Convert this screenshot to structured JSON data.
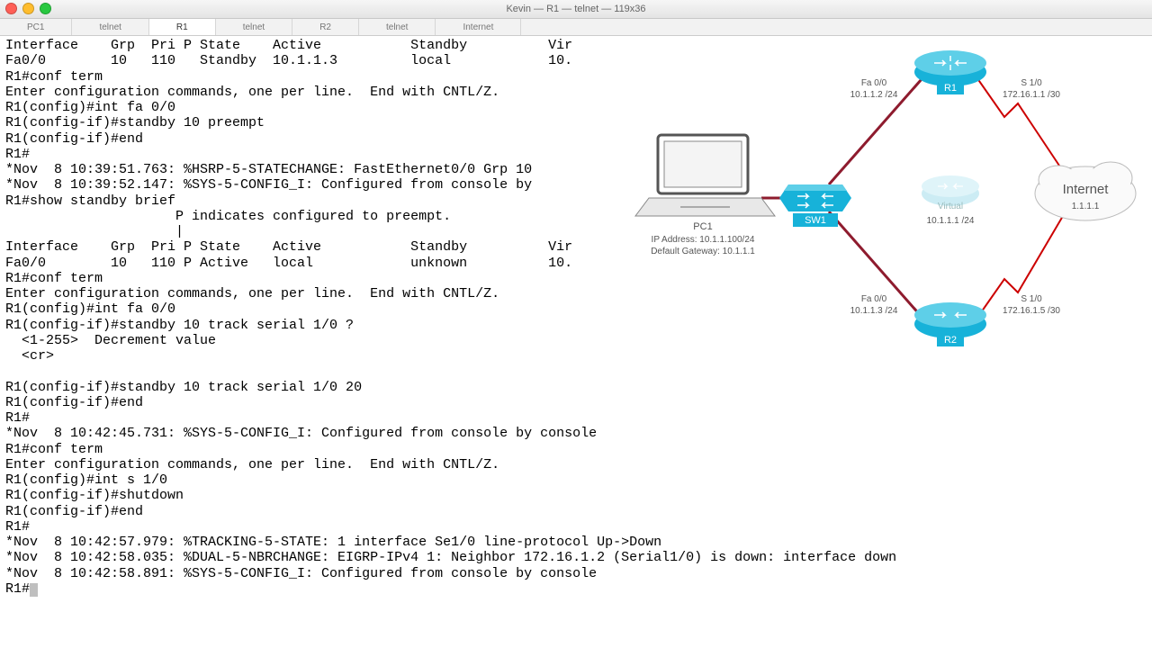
{
  "window": {
    "title": "Kevin — R1 — telnet — 119x36"
  },
  "tabs": {
    "items": [
      "PC1",
      "telnet",
      "R1",
      "telnet",
      "R2",
      "telnet",
      "Internet"
    ],
    "active_index": 2
  },
  "terminal": {
    "text": "Interface    Grp  Pri P State    Active           Standby          Vir\nFa0/0        10   110   Standby  10.1.1.3         local            10.\nR1#conf term\nEnter configuration commands, one per line.  End with CNTL/Z.\nR1(config)#int fa 0/0\nR1(config-if)#standby 10 preempt\nR1(config-if)#end\nR1#\n*Nov  8 10:39:51.763: %HSRP-5-STATECHANGE: FastEthernet0/0 Grp 10\n*Nov  8 10:39:52.147: %SYS-5-CONFIG_I: Configured from console by\nR1#show standby brief\n                     P indicates configured to preempt.\n                     |\nInterface    Grp  Pri P State    Active           Standby          Vir\nFa0/0        10   110 P Active   local            unknown          10.\nR1#conf term\nEnter configuration commands, one per line.  End with CNTL/Z.\nR1(config)#int fa 0/0\nR1(config-if)#standby 10 track serial 1/0 ?\n  <1-255>  Decrement value\n  <cr>\n\nR1(config-if)#standby 10 track serial 1/0 20\nR1(config-if)#end\nR1#\n*Nov  8 10:42:45.731: %SYS-5-CONFIG_I: Configured from console by console\nR1#conf term\nEnter configuration commands, one per line.  End with CNTL/Z.\nR1(config)#int s 1/0\nR1(config-if)#shutdown\nR1(config-if)#end\nR1#\n*Nov  8 10:42:57.979: %TRACKING-5-STATE: 1 interface Se1/0 line-protocol Up->Down\n*Nov  8 10:42:58.035: %DUAL-5-NBRCHANGE: EIGRP-IPv4 1: Neighbor 172.16.1.2 (Serial1/0) is down: interface down\n*Nov  8 10:42:58.891: %SYS-5-CONFIG_I: Configured from console by console\nR1#"
  },
  "diagram": {
    "pc": {
      "name": "PC1",
      "ip": "IP Address: 10.1.1.100/24",
      "gw": "Default Gateway: 10.1.1.1"
    },
    "sw": "SW1",
    "r1": {
      "name": "R1",
      "left_if": "Fa 0/0",
      "left_ip": "10.1.1.2 /24",
      "right_if": "S 1/0",
      "right_ip": "172.16.1.1 /30"
    },
    "r2": {
      "name": "R2",
      "left_if": "Fa 0/0",
      "left_ip": "10.1.1.3 /24",
      "right_if": "S 1/0",
      "right_ip": "172.16.1.5 /30"
    },
    "virtual": {
      "name": "Virtual",
      "ip": "10.1.1.1 /24"
    },
    "internet": {
      "name": "Internet",
      "ip": "1.1.1.1"
    }
  }
}
